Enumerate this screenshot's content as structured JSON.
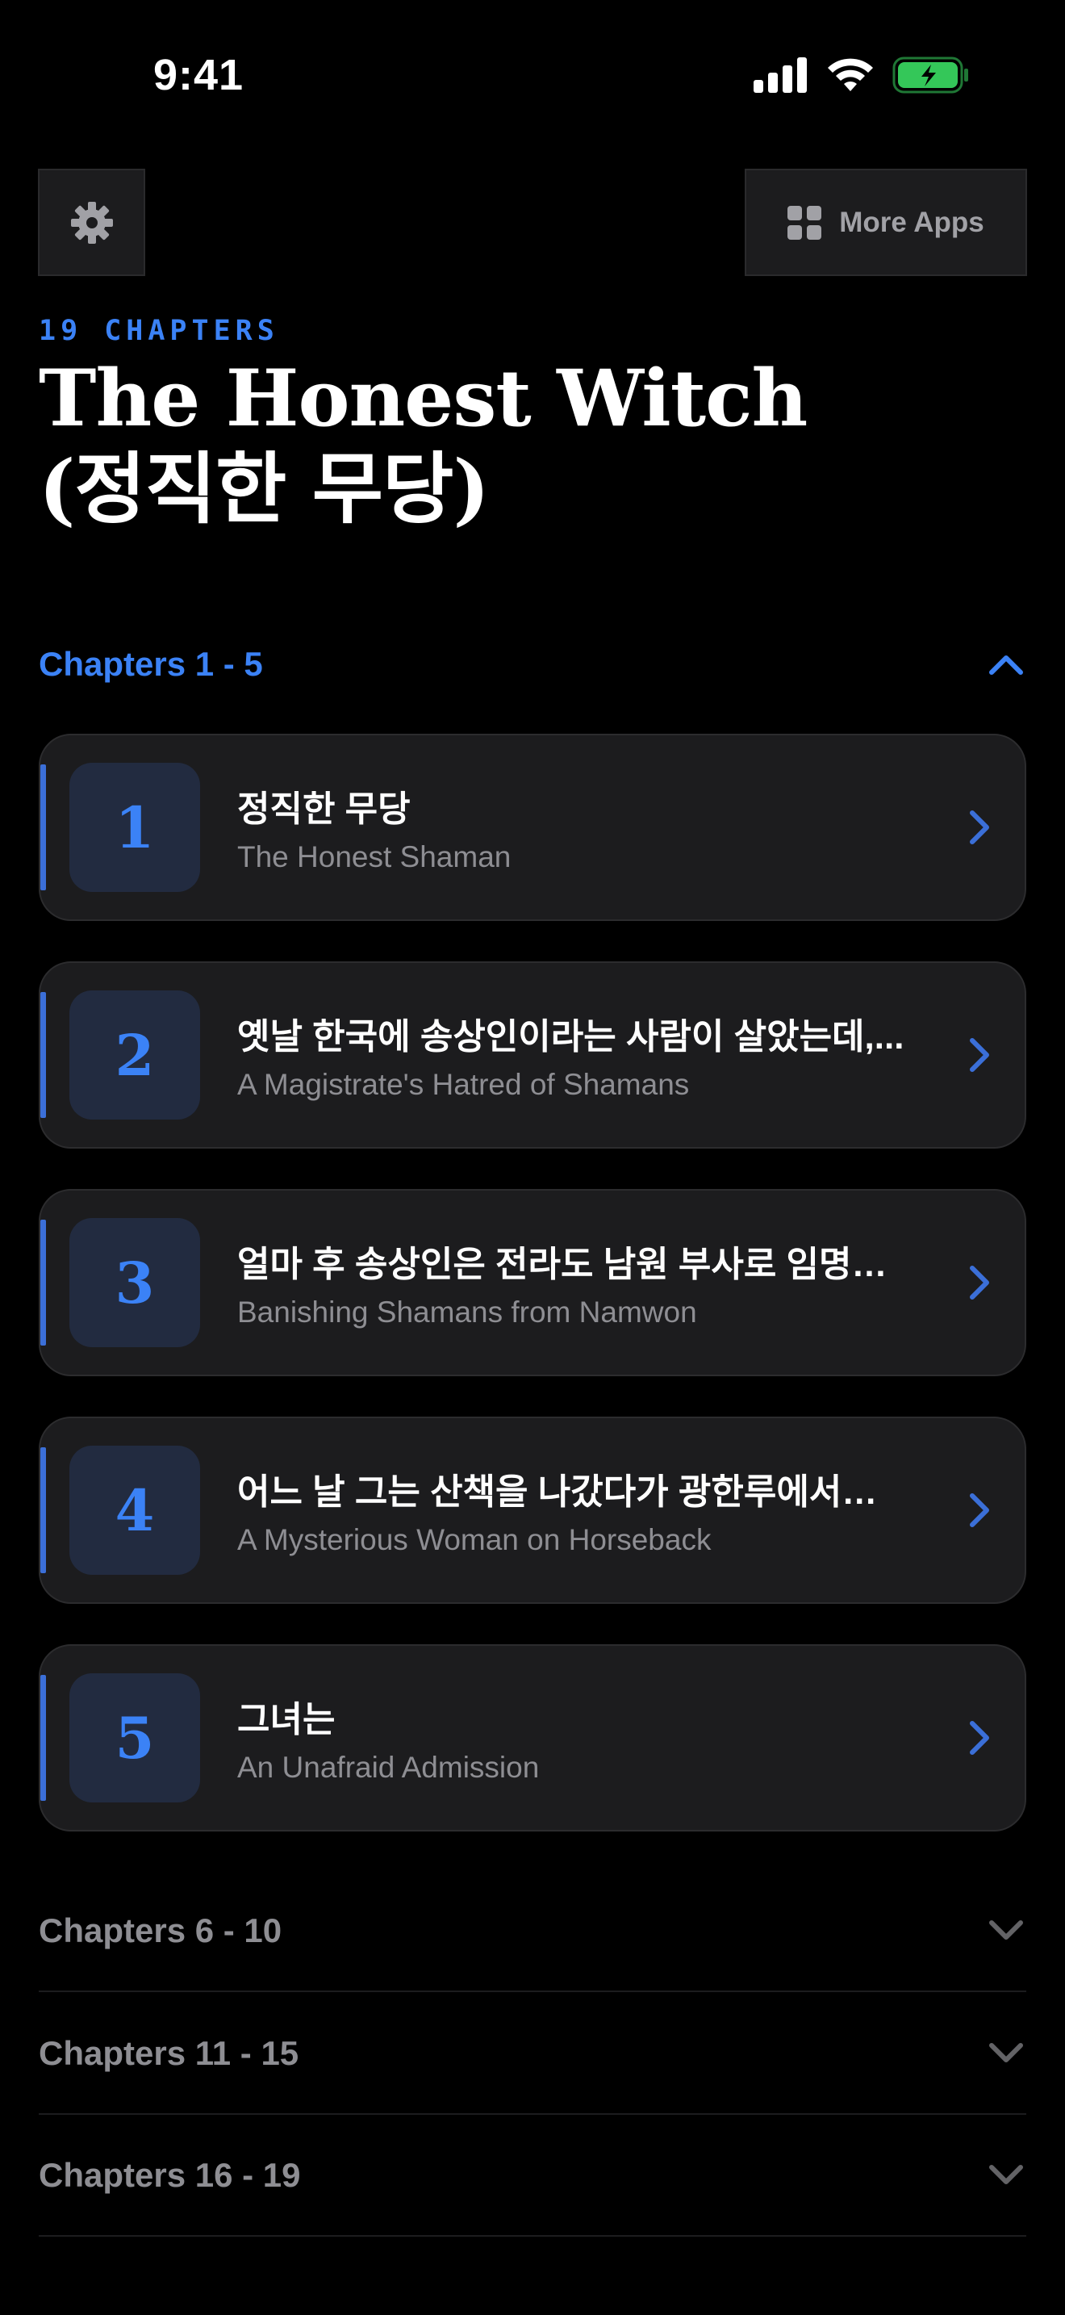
{
  "status_bar": {
    "time": "9:41"
  },
  "top_bar": {
    "more_apps_label": "More Apps"
  },
  "header": {
    "chapter_count": "19 CHAPTERS",
    "title_line1": "The Honest Witch",
    "title_line2": "(정직한 무당)"
  },
  "sections": [
    {
      "label": "Chapters 1 - 5",
      "expanded": true
    },
    {
      "label": "Chapters 6 - 10",
      "expanded": false
    },
    {
      "label": "Chapters 11 - 15",
      "expanded": false
    },
    {
      "label": "Chapters 16 - 19",
      "expanded": false
    }
  ],
  "chapters": [
    {
      "number": "1",
      "korean": "정직한 무당",
      "english": "The Honest Shaman"
    },
    {
      "number": "2",
      "korean": "옛날 한국에 송상인이라는 사람이 살았는데,...",
      "english": "A Magistrate's Hatred of Shamans"
    },
    {
      "number": "3",
      "korean": "얼마 후 송상인은 전라도 남원 부사로 임명되…",
      "english": "Banishing Shamans from Namwon"
    },
    {
      "number": "4",
      "korean": "어느 날 그는 산책을 나갔다가 광한루에서…",
      "english": "A Mysterious Woman on Horseback"
    },
    {
      "number": "5",
      "korean": "그녀는",
      "english": "An Unafraid Admission"
    }
  ],
  "colors": {
    "accent": "#3b82f6",
    "card_bg": "#1c1c1e",
    "battery": "#34c759"
  },
  "icons": [
    "gear-icon",
    "grid-icon",
    "chevron-up-icon",
    "chevron-down-icon",
    "chevron-right-icon",
    "signal-icon",
    "wifi-icon",
    "battery-icon"
  ]
}
